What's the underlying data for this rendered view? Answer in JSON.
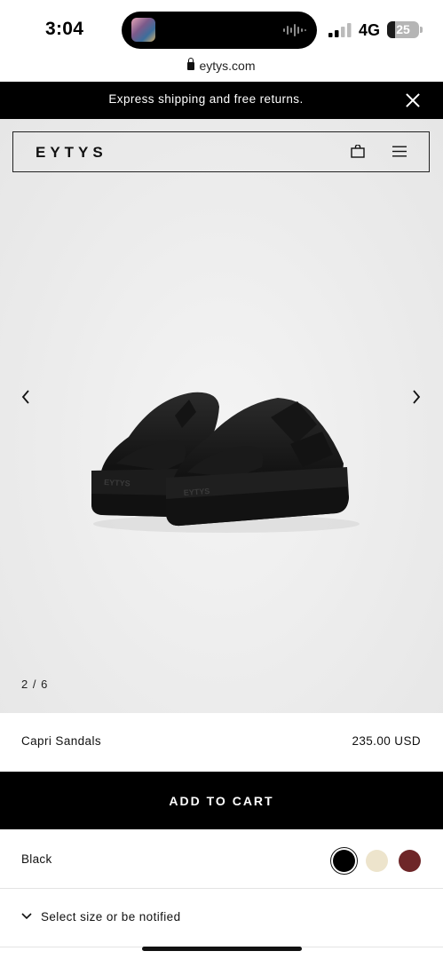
{
  "status_bar": {
    "time": "3:04",
    "network": "4G",
    "battery": "25",
    "battery_level": 0.25
  },
  "browser": {
    "url": "eytys.com"
  },
  "promo": {
    "text": "Express shipping and free returns."
  },
  "header": {
    "logo": "EYTYS"
  },
  "gallery": {
    "counter": "2 / 6",
    "current_index": 2,
    "total": 6
  },
  "product": {
    "name": "Capri Sandals",
    "price": "235.00 USD"
  },
  "cart": {
    "button_label": "ADD TO CART"
  },
  "color": {
    "selected": "Black",
    "swatches": [
      {
        "name": "black",
        "color": "#000000",
        "selected": true
      },
      {
        "name": "cream",
        "color": "#ede4cc",
        "selected": false
      },
      {
        "name": "burgundy",
        "color": "#6e2628",
        "selected": false
      }
    ]
  },
  "size": {
    "label": "Select size or be notified"
  },
  "icons": [
    "lock-icon",
    "close-icon",
    "bag-icon",
    "menu-icon",
    "chevron-left-icon",
    "chevron-right-icon",
    "chevron-down-icon"
  ]
}
